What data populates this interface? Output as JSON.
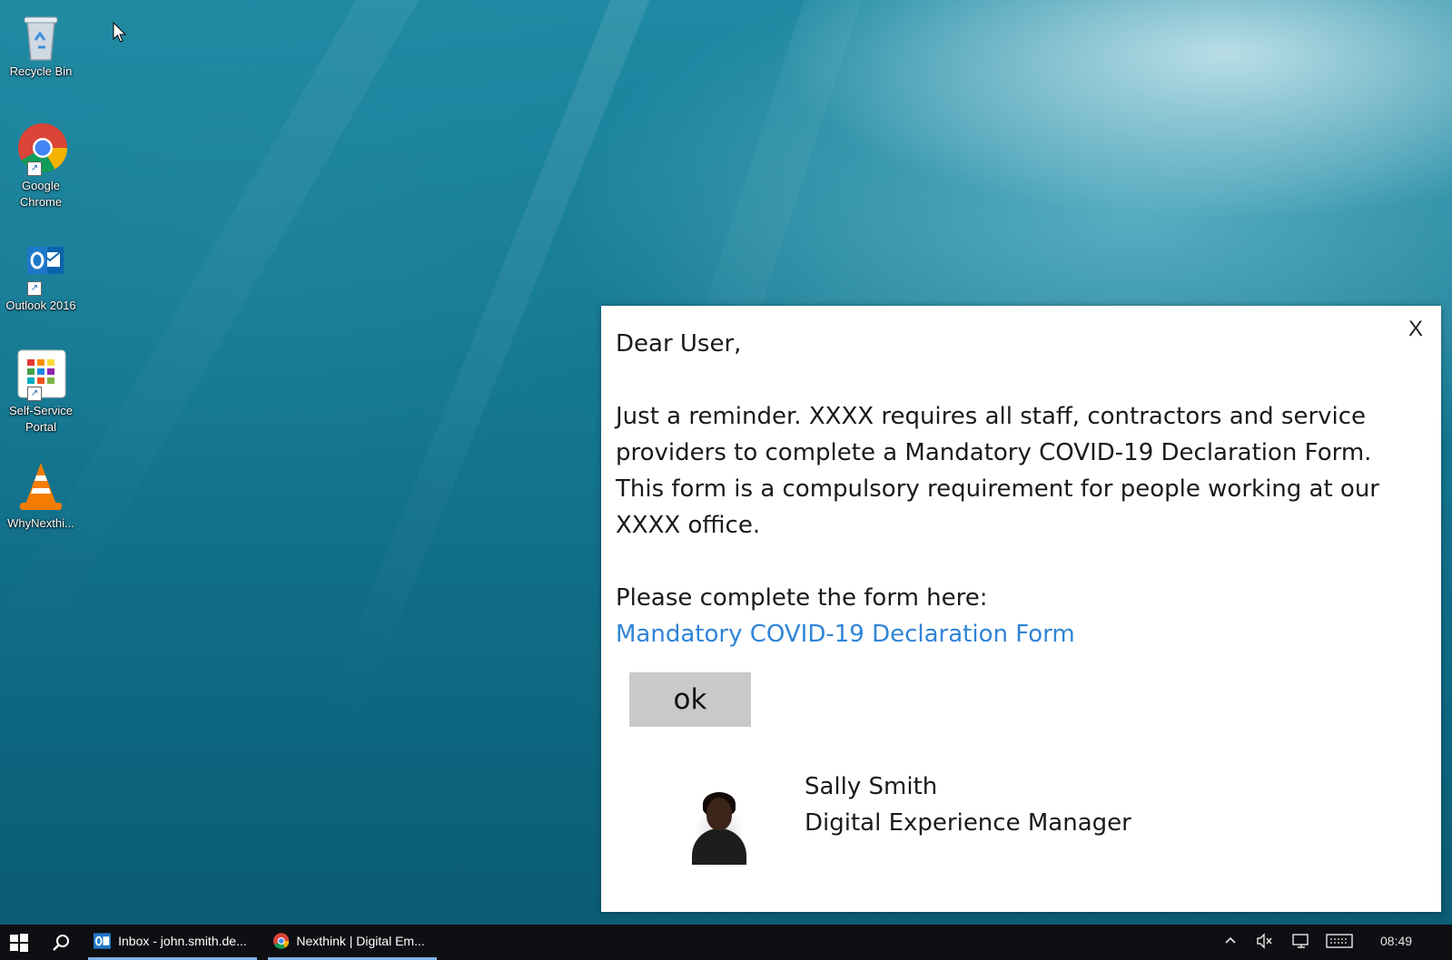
{
  "desktop": {
    "icons": [
      {
        "label": "Recycle Bin",
        "icon": "recycle-bin-icon"
      },
      {
        "label": "Google Chrome",
        "icon": "chrome-icon"
      },
      {
        "label": "Outlook 2016",
        "icon": "outlook-icon"
      },
      {
        "label": "Self-Service Portal",
        "icon": "portal-icon"
      },
      {
        "label": "WhyNexthi...",
        "icon": "vlc-cone-icon"
      }
    ]
  },
  "popup": {
    "close_label": "X",
    "greeting": "Dear User,",
    "message": "Just a reminder. XXXX requires all staff, contractors and service providers to complete a Mandatory COVID-19 Declaration Form. This form is a compulsory requirement for people working at our XXXX office.",
    "prompt": "Please complete the form here:",
    "link_text": "Mandatory COVID-19 Declaration Form",
    "ok_label": "ok",
    "sender_name": "Sally Smith",
    "sender_title": "Digital Experience Manager",
    "link_color": "#2f84d6"
  },
  "taskbar": {
    "apps": [
      {
        "label": "Inbox - john.smith.de...",
        "icon": "outlook-icon"
      },
      {
        "label": "Nexthink | Digital Em...",
        "icon": "chrome-icon"
      }
    ],
    "clock": "08:49",
    "tray_icons": [
      "chevron-up-icon",
      "volume-muted-icon",
      "network-icon",
      "keyboard-icon"
    ]
  }
}
